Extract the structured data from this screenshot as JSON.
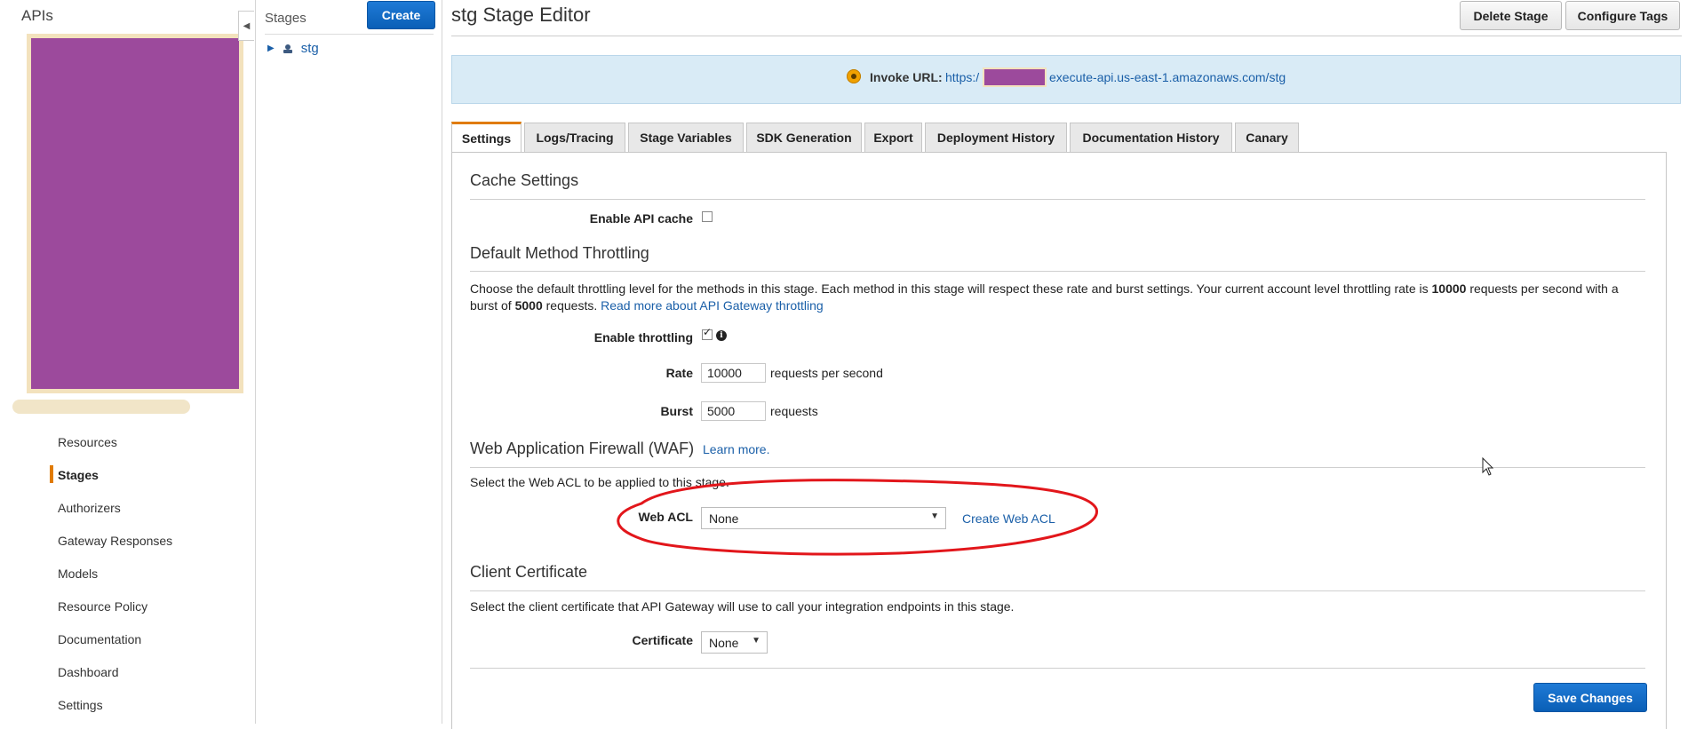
{
  "sidebar": {
    "title": "APIs",
    "items": [
      {
        "label": "Resources",
        "active": false
      },
      {
        "label": "Stages",
        "active": true
      },
      {
        "label": "Authorizers",
        "active": false
      },
      {
        "label": "Gateway Responses",
        "active": false
      },
      {
        "label": "Models",
        "active": false
      },
      {
        "label": "Resource Policy",
        "active": false
      },
      {
        "label": "Documentation",
        "active": false
      },
      {
        "label": "Dashboard",
        "active": false
      },
      {
        "label": "Settings",
        "active": false
      }
    ]
  },
  "stages_panel": {
    "title": "Stages",
    "create_label": "Create",
    "stage_name": "stg"
  },
  "header": {
    "title": "stg Stage Editor",
    "delete_label": "Delete Stage",
    "configure_label": "Configure Tags"
  },
  "invoke": {
    "label": "Invoke URL:",
    "url_prefix": "https:/",
    "url_suffix": "execute-api.us-east-1.amazonaws.com/stg"
  },
  "tabs": [
    {
      "label": "Settings",
      "active": true
    },
    {
      "label": "Logs/Tracing"
    },
    {
      "label": "Stage Variables"
    },
    {
      "label": "SDK Generation"
    },
    {
      "label": "Export"
    },
    {
      "label": "Deployment History"
    },
    {
      "label": "Documentation History"
    },
    {
      "label": "Canary"
    }
  ],
  "cache": {
    "heading": "Cache Settings",
    "enable_label": "Enable API cache",
    "enabled": false
  },
  "throttling": {
    "heading": "Default Method Throttling",
    "description_1": "Choose the default throttling level for the methods in this stage. Each method in this stage will respect these rate and burst settings. Your current account level throttling rate is ",
    "account_rate": "10000",
    "description_2": " requests per second with a",
    "description_3": "burst of ",
    "account_burst": "5000",
    "description_4": " requests. ",
    "read_more": "Read more about API Gateway throttling",
    "enable_label": "Enable throttling",
    "enabled": true,
    "rate_label": "Rate",
    "rate_value": "10000",
    "rate_unit": "requests per second",
    "burst_label": "Burst",
    "burst_value": "5000",
    "burst_unit": "requests"
  },
  "waf": {
    "heading": "Web Application Firewall (WAF)",
    "learn_more": "Learn more.",
    "description": "Select the Web ACL to be applied to this stage.",
    "acl_label": "Web ACL",
    "acl_value": "None",
    "create_link": "Create Web ACL"
  },
  "client_cert": {
    "heading": "Client Certificate",
    "description": "Select the client certificate that API Gateway will use to call your integration endpoints in this stage.",
    "cert_label": "Certificate",
    "cert_value": "None"
  },
  "footer": {
    "save_label": "Save Changes"
  },
  "colors": {
    "accent_orange": "#e07b00",
    "primary_blue": "#0a5fb6",
    "link_blue": "#1a5fa8",
    "annotation_red": "#e2161b",
    "redaction_purple": "#9c4a9c"
  },
  "icons": [
    "collapse-arrow-icon",
    "stage-tree-icon",
    "invoke-status-icon",
    "info-icon",
    "select-caret-icon",
    "mouse-cursor-icon"
  ]
}
